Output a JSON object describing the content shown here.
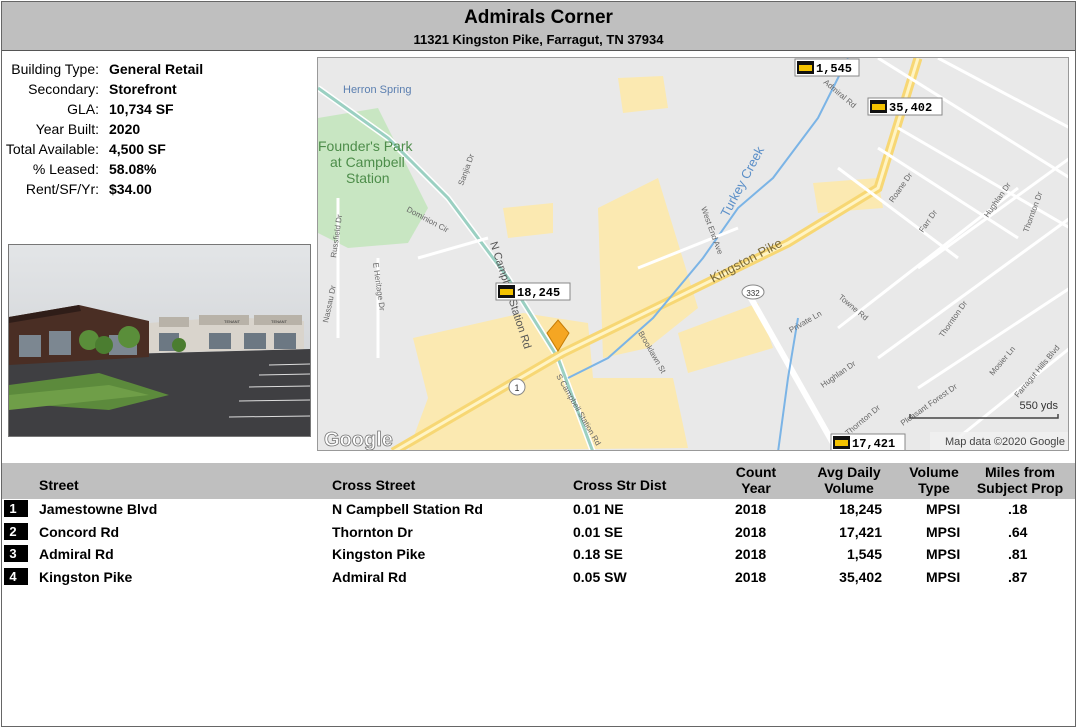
{
  "header": {
    "title": "Admirals Corner",
    "address": "11321 Kingston Pike, Farragut, TN 37934"
  },
  "property": [
    {
      "label": "Building Type:",
      "value": "General Retail"
    },
    {
      "label": "Secondary:",
      "value": "Storefront"
    },
    {
      "label": "GLA:",
      "value": "10,734 SF"
    },
    {
      "label": "Year Built:",
      "value": "2020"
    },
    {
      "label": "Total Available:",
      "value": "4,500 SF"
    },
    {
      "label": "% Leased:",
      "value": "58.08%"
    },
    {
      "label": "Rent/SF/Yr:",
      "value": "$34.00"
    }
  ],
  "photo": {
    "signs": [
      "TENANT",
      "TENANT"
    ]
  },
  "map": {
    "places": {
      "herron_spring": "Herron Spring",
      "park_line1": "Founder's Park",
      "park_line2": "at Campbell",
      "park_line3": "Station",
      "turkey_creek": "Turkey Creek"
    },
    "roads": {
      "kingston_pike": "Kingston Pike",
      "n_campbell": "N Campbell Station Rd",
      "s_campbell": "S Campbell Station Rd",
      "admiral": "Admiral Rd",
      "sanjia": "Sanjia Dr",
      "dominion": "Dominion Cir",
      "russfield": "Russfield Dr",
      "heritage": "E Heritage Dr",
      "nassau": "Nassau Dr",
      "brooklawn": "Brooklawn St",
      "west_end": "West End Ave",
      "roane": "Roane Dr",
      "farr": "Farr Dr",
      "hughlan_ne": "Hughlan Dr",
      "thornton_ne": "Thornton Dr",
      "towne": "Towne Rd",
      "private": "Private Ln",
      "hughlan_s": "Hughlan Dr",
      "thornton_s": "Thornton Dr",
      "thornton_b": "Thornton Dr",
      "pleasant": "Pleasant Forest Dr",
      "mosier": "Mosier Ln",
      "farragut_hills": "Farragut Hills Blvd"
    },
    "shields": {
      "us1": "1",
      "sr332": "332"
    },
    "counts": [
      "1,545",
      "35,402",
      "18,245",
      "17,421"
    ],
    "scale": "550 yds",
    "attribution": "Map data ©2020 Google",
    "logo": "Google"
  },
  "traffic": {
    "columns": {
      "street": "Street",
      "cross_street": "Cross Street",
      "cross_dist": "Cross Str Dist",
      "count_year_1": "Count",
      "count_year_2": "Year",
      "avg_daily_1": "Avg Daily",
      "avg_daily_2": "Volume",
      "volume_type_1": "Volume",
      "volume_type_2": "Type",
      "miles_1": "Miles from",
      "miles_2": "Subject Prop"
    },
    "rows": [
      {
        "num": "1",
        "street": "Jamestowne Blvd",
        "cross": "N Campbell Station Rd",
        "dist": "0.01 NE",
        "year": "2018",
        "volume": "18,245",
        "type": "MPSI",
        "miles": ".18"
      },
      {
        "num": "2",
        "street": "Concord Rd",
        "cross": "Thornton Dr",
        "dist": "0.01 SE",
        "year": "2018",
        "volume": "17,421",
        "type": "MPSI",
        "miles": ".64"
      },
      {
        "num": "3",
        "street": "Admiral Rd",
        "cross": "Kingston Pike",
        "dist": "0.18 SE",
        "year": "2018",
        "volume": "1,545",
        "type": "MPSI",
        "miles": ".81"
      },
      {
        "num": "4",
        "street": "Kingston Pike",
        "cross": "Admiral Rd",
        "dist": "0.05 SW",
        "year": "2018",
        "volume": "35,402",
        "type": "MPSI",
        "miles": ".87"
      }
    ]
  }
}
